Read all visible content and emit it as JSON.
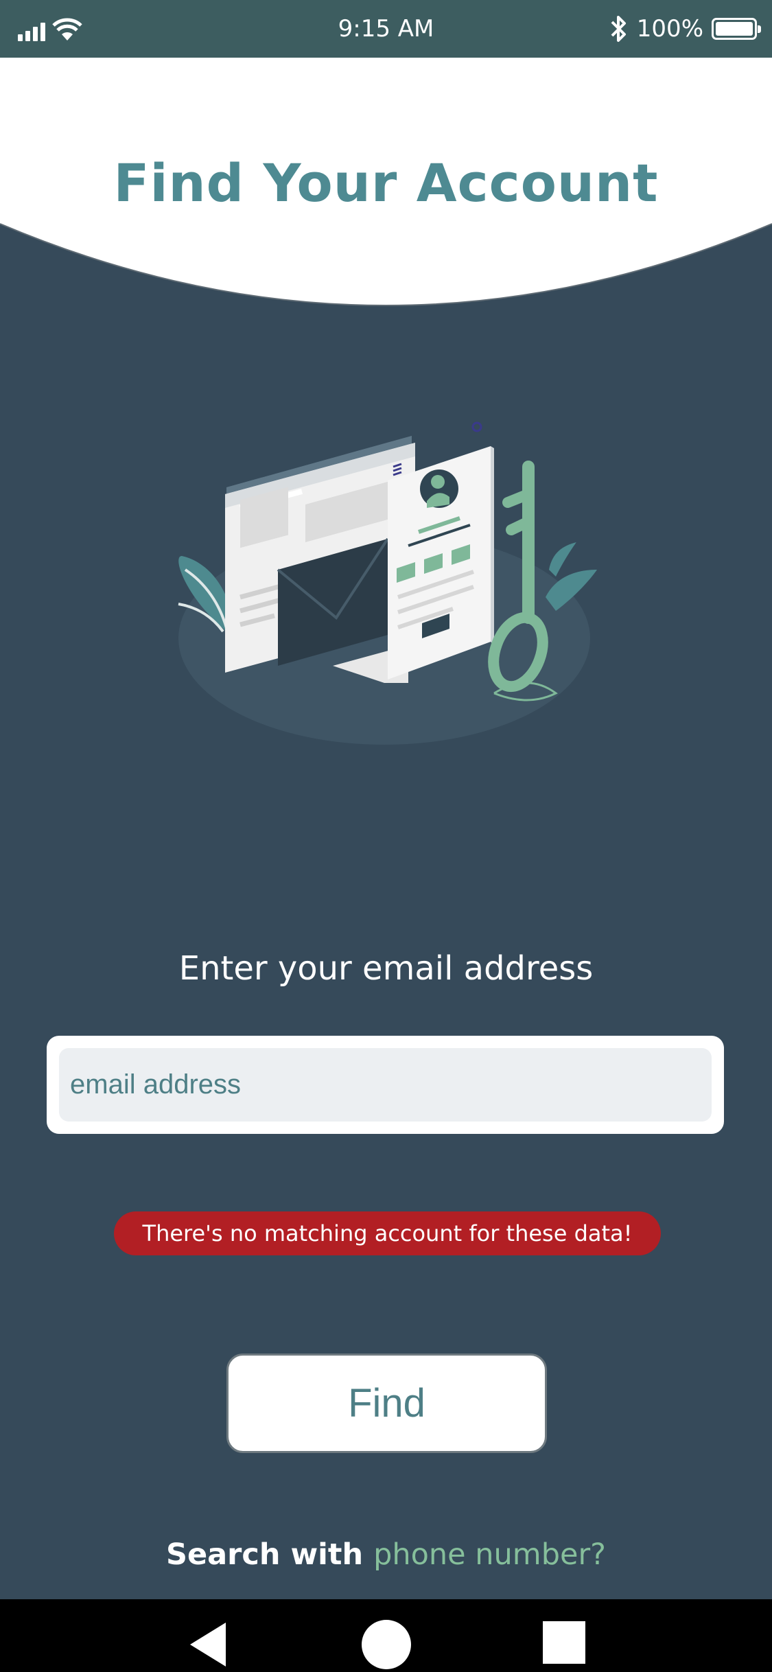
{
  "status_bar": {
    "time": "9:15 AM",
    "battery_percent": "100%",
    "battery_level": 1.0,
    "icons": [
      "signal-icon",
      "wifi-icon",
      "bluetooth-icon",
      "battery-icon"
    ]
  },
  "header": {
    "title": "Find Your Account"
  },
  "illustration": {
    "icon": "account-recovery-illustration"
  },
  "form": {
    "prompt": "Enter your email address",
    "email_placeholder": "email address",
    "email_value": "",
    "error_message": "There's no matching account for these data!",
    "find_label": "Find"
  },
  "alternate": {
    "prefix": "Search with ",
    "link_label": "phone number?"
  },
  "colors": {
    "background": "#364a5a",
    "status_bar": "#3d5d60",
    "title": "#4e8a92",
    "accent_green": "#86bf9b",
    "error": "#b21f24"
  },
  "nav_bar": {
    "icons": [
      "back-icon",
      "home-icon",
      "recents-icon"
    ]
  }
}
